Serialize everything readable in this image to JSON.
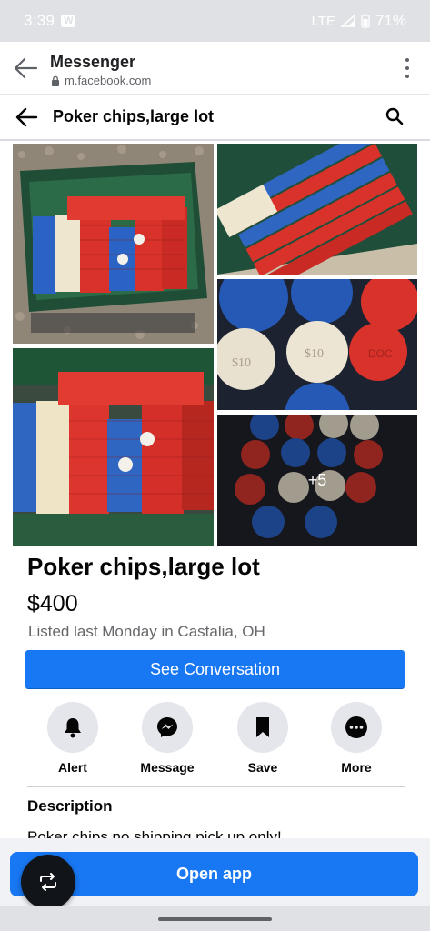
{
  "status_bar": {
    "time": "3:39",
    "app_badge": "W",
    "network": "LTE",
    "battery": "71%"
  },
  "browser": {
    "title": "Messenger",
    "url": "m.facebook.com",
    "icons": {
      "back": "arrow-left-icon",
      "lock": "lock-icon",
      "menu": "kebab-menu-icon"
    }
  },
  "header": {
    "title": "Poker chips,large lot",
    "icons": {
      "back": "arrow-left-icon",
      "search": "search-icon"
    }
  },
  "photos": {
    "more_count": "+5"
  },
  "listing": {
    "title": "Poker chips,large lot",
    "price": "$400",
    "meta": "Listed last Monday in Castalia, OH",
    "see_conversation_label": "See Conversation"
  },
  "actions": {
    "alert": "Alert",
    "message": "Message",
    "save": "Save",
    "more": "More"
  },
  "description": {
    "heading": "Description",
    "text": "Poker chips,no shipping pick up only!"
  },
  "bottom": {
    "open_app_label": "Open app",
    "fab_icon": "repost-icon"
  },
  "colors": {
    "accent": "#1877f2",
    "status_bar": "#dfe1e5",
    "action_circle": "#e4e6eb"
  }
}
